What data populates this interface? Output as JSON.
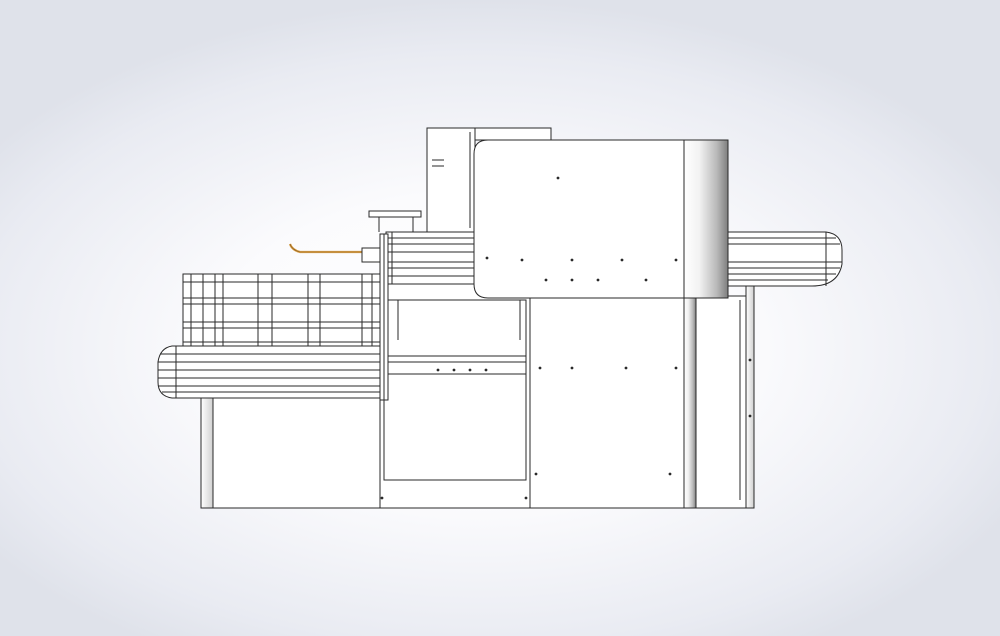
{
  "scene": {
    "background_color_center": "#ffffff",
    "background_color_edge": "#dfe2ea",
    "line_color": "#2a2a2a",
    "handle_color": "#d9a14a",
    "drum_shade_dark": "#8a8a8a"
  }
}
